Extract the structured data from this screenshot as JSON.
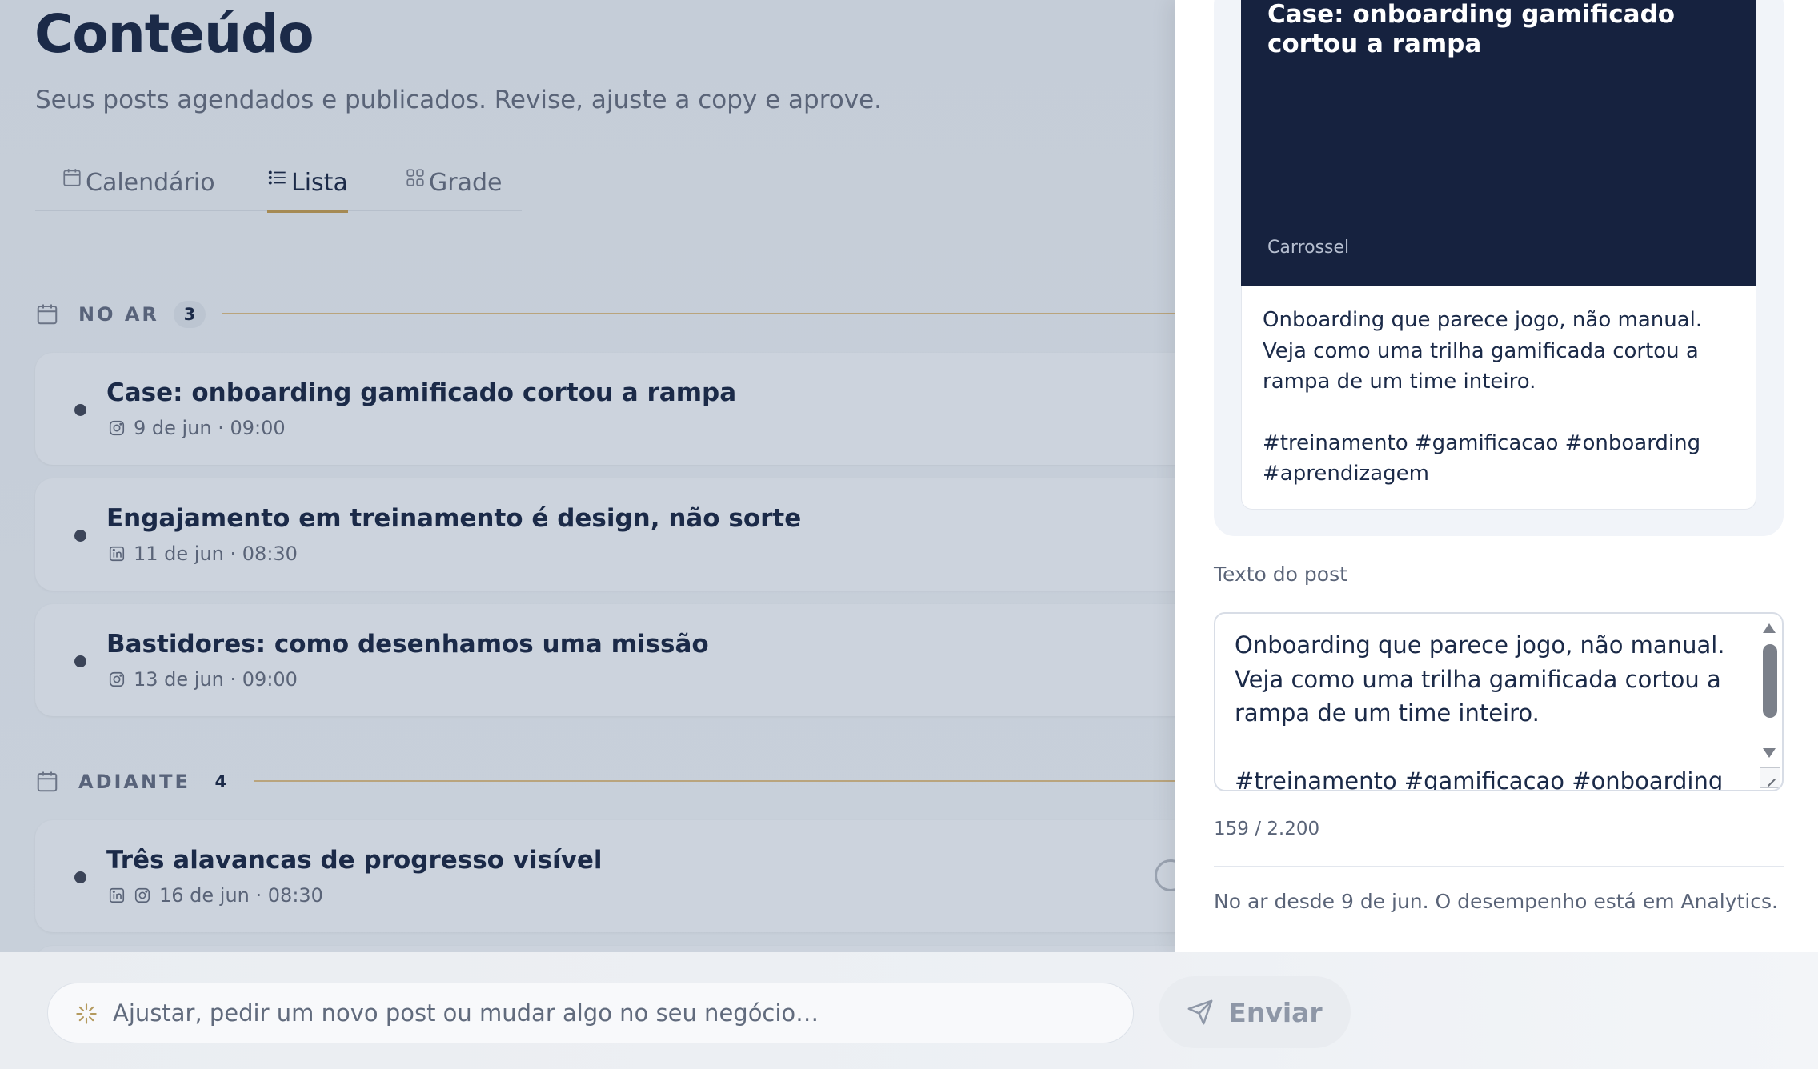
{
  "header": {
    "title": "Conteúdo",
    "subtitle": "Seus posts agendados e publicados. Revise, ajuste a copy e aprove."
  },
  "view_tabs": [
    {
      "label": "Calendário",
      "icon": "calendar-icon",
      "active": false
    },
    {
      "label": "Lista",
      "icon": "list-icon",
      "active": true
    },
    {
      "label": "Grade",
      "icon": "grid-icon",
      "active": false
    }
  ],
  "sections": [
    {
      "label": "NO AR",
      "count": "3",
      "posts": [
        {
          "title": "Case: onboarding gamificado cortou a rampa",
          "networks": [
            "instagram"
          ],
          "when": "9 de jun · 09:00"
        },
        {
          "title": "Engajamento em treinamento é design, não sorte",
          "networks": [
            "linkedin"
          ],
          "when": "11 de jun · 08:30"
        },
        {
          "title": "Bastidores: como desenhamos uma missão",
          "networks": [
            "instagram"
          ],
          "when": "13 de jun · 09:00"
        }
      ]
    },
    {
      "label": "ADIANTE",
      "count": "4",
      "posts": [
        {
          "title": "Três alavancas de progresso visível",
          "networks": [
            "linkedin",
            "instagram"
          ],
          "when": "16 de jun · 08:30"
        }
      ]
    }
  ],
  "detail": {
    "preview_title": "Case: onboarding gamificado cortou a rampa",
    "preview_format": "Carrossel",
    "caption_line1": "Onboarding que parece jogo, não manual. Veja como uma trilha gamificada cortou a rampa de um time inteiro.",
    "caption_hashtags": "#treinamento #gamificacao #onboarding #aprendizagem",
    "field_label": "Texto do post",
    "text_line1": "Onboarding que parece jogo, não manual. Veja como uma trilha gamificada cortou a rampa de um time inteiro.",
    "text_hashtags": "#treinamento #gamificacao #onboarding",
    "char_count": "159 / 2.200",
    "status_note": "No ar desde 9 de jun. O desempenho está em Analytics."
  },
  "chat": {
    "placeholder": "Ajustar, pedir um novo post ou mudar algo no seu negócio…",
    "send_label": "Enviar"
  },
  "colors": {
    "navy": "#1b2a48",
    "preview_bg": "#16223f",
    "accent_gold": "#a58a54"
  }
}
